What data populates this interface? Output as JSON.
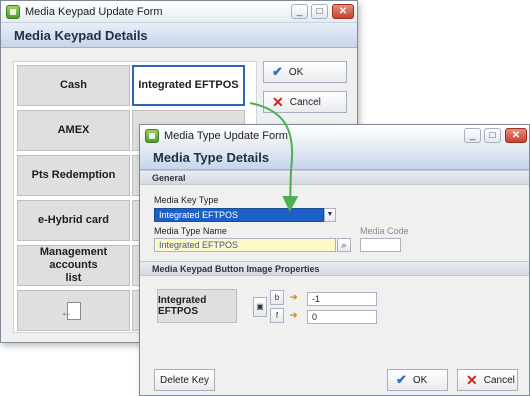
{
  "keypad_form": {
    "title": "Media Keypad Update Form",
    "header": "Media Keypad Details",
    "buttons": {
      "cash": "Cash",
      "integrated_eftpos": "Integrated EFTPOS",
      "amex": "AMEX",
      "pts_redemption": "Pts Redemption",
      "ehybrid": "e-Hybrid card",
      "mgmt_line1": "Management accounts",
      "mgmt_line2": "list"
    },
    "ok_label": "OK",
    "cancel_label": "Cancel"
  },
  "type_form": {
    "title": "Media Type Update Form",
    "header": "Media Type Details",
    "general_section": "General",
    "media_key_type_label": "Media Key Type",
    "media_key_type_value": "Integrated EFTPOS",
    "media_type_name_label": "Media Type Name",
    "media_type_name_value": "Integrated EFTPOS",
    "media_code_label": "Media Code",
    "media_code_value": "",
    "image_section": "Media Keypad Button Image Properties",
    "preview_button_label": "Integrated EFTPOS",
    "b_label": "b",
    "f_label": "f",
    "b_value": "-1",
    "f_value": "0",
    "delete_key_label": "Delete Key",
    "ok_label": "OK",
    "cancel_label": "Cancel"
  },
  "window_controls": {
    "minimize": "_",
    "maximize": "□",
    "close": "✕"
  },
  "colors": {
    "header_text": "#1f2f44",
    "selection_blue": "#1c5fc7",
    "name_field_yellow": "#fdf8c8",
    "arrow_green": "#4caf50",
    "ok_blue": "#2d6fc2",
    "cancel_red": "#c8261a"
  }
}
